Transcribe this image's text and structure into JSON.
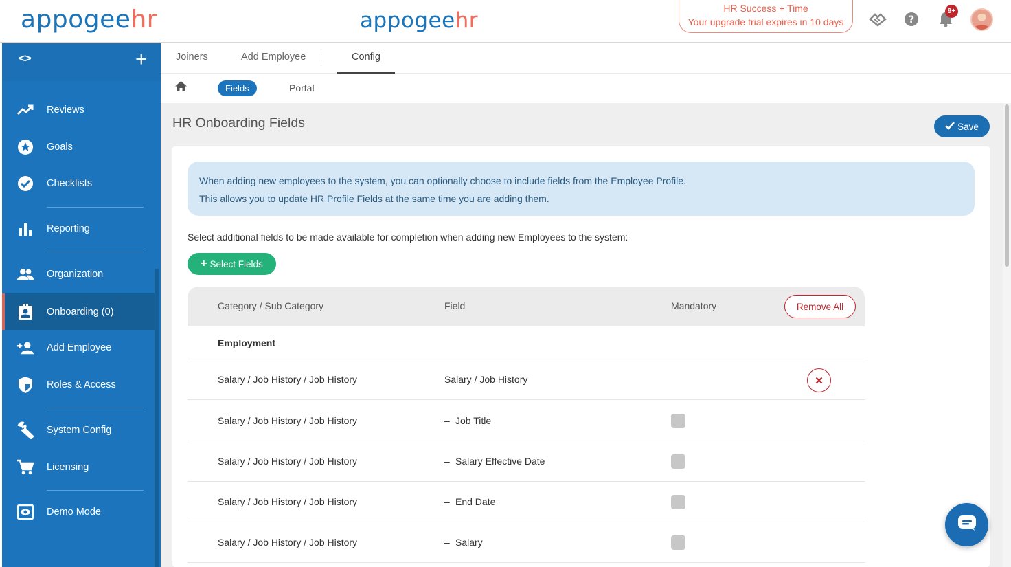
{
  "header": {
    "logo_part1": "appogee",
    "logo_part2": "hr",
    "trial_line1": "HR Success + Time",
    "trial_line2": "Your upgrade trial expires in 10 days",
    "notification_count": "9+"
  },
  "sidebar": {
    "collapse_label": "<>",
    "add_label": "+",
    "items": [
      {
        "label": "Reviews",
        "icon": "trending-up-icon"
      },
      {
        "label": "Goals",
        "icon": "star-circle-icon"
      },
      {
        "label": "Checklists",
        "icon": "check-circle-icon"
      },
      {
        "label": "Reporting",
        "icon": "bar-chart-icon"
      },
      {
        "label": "Organization",
        "icon": "people-icon"
      },
      {
        "label": "Onboarding (0)",
        "icon": "badge-icon"
      },
      {
        "label": "Add Employee",
        "icon": "add-person-icon"
      },
      {
        "label": "Roles & Access",
        "icon": "shield-icon"
      },
      {
        "label": "System Config",
        "icon": "wrench-icon"
      },
      {
        "label": "Licensing",
        "icon": "cart-icon"
      },
      {
        "label": "Demo Mode",
        "icon": "eye-icon"
      }
    ],
    "active_index": 5
  },
  "tabs": {
    "items": [
      "Joiners",
      "Add Employee",
      "Config"
    ],
    "active": "Config"
  },
  "subtabs": {
    "fields": "Fields",
    "portal": "Portal"
  },
  "main": {
    "title": "HR Onboarding Fields",
    "save_label": "Save",
    "info_line1": "When adding new employees to the system, you can optionally choose to include fields from the Employee Profile.",
    "info_line2": "This allows you to update HR Profile Fields at the same time you are adding them.",
    "instruction": "Select additional fields to be made available for completion when adding new Employees to the system:",
    "select_fields_label": "Select Fields"
  },
  "table": {
    "headers": {
      "category": "Category / Sub Category",
      "field": "Field",
      "mandatory": "Mandatory",
      "remove_all": "Remove All"
    },
    "group": "Employment",
    "rows": [
      {
        "category": "Salary / Job History / Job History",
        "field": "Salary / Job History",
        "type": "parent"
      },
      {
        "category": "Salary / Job History / Job History",
        "field": "Job Title",
        "type": "child"
      },
      {
        "category": "Salary / Job History / Job History",
        "field": "Salary Effective Date",
        "type": "child"
      },
      {
        "category": "Salary / Job History / Job History",
        "field": "End Date",
        "type": "child"
      },
      {
        "category": "Salary / Job History / Job History",
        "field": "Salary",
        "type": "child"
      }
    ]
  },
  "colors": {
    "brand_blue": "#1c75bc",
    "brand_orange": "#f26b5b",
    "success_green": "#25b27a",
    "danger_red": "#c0272d"
  }
}
